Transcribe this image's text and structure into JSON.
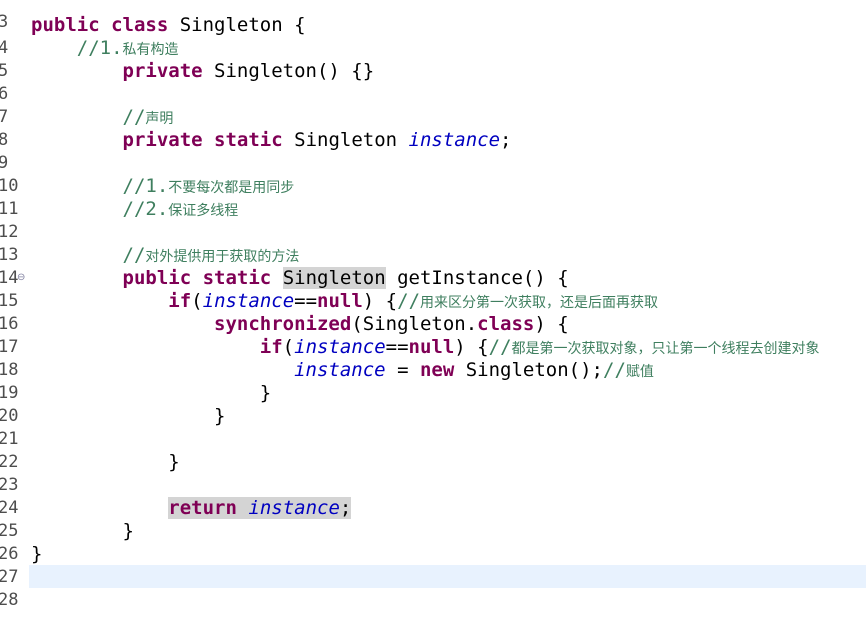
{
  "editor": {
    "lines": [
      {
        "n": "3"
      },
      {
        "n": "4"
      },
      {
        "n": "5"
      },
      {
        "n": "6"
      },
      {
        "n": "7"
      },
      {
        "n": "8"
      },
      {
        "n": "9"
      },
      {
        "n": "10"
      },
      {
        "n": "11"
      },
      {
        "n": "12"
      },
      {
        "n": "13"
      },
      {
        "n": "14"
      },
      {
        "n": "15"
      },
      {
        "n": "16"
      },
      {
        "n": "17"
      },
      {
        "n": "18"
      },
      {
        "n": "19"
      },
      {
        "n": "20"
      },
      {
        "n": "21"
      },
      {
        "n": "22"
      },
      {
        "n": "23"
      },
      {
        "n": "24"
      },
      {
        "n": "25"
      },
      {
        "n": "26"
      },
      {
        "n": "27"
      },
      {
        "n": "28"
      }
    ],
    "fold_marker": "⊖",
    "tokens": {
      "l4": {
        "kw1": "public",
        "kw2": "class",
        "name": " Singleton {"
      },
      "l5": {
        "c1": "//1.",
        "c2": "私有构造"
      },
      "l6": {
        "kw": "private",
        "rest": " Singleton() {}"
      },
      "l8": {
        "c1": "//",
        "c2": "声明"
      },
      "l9": {
        "kw1": "private",
        "kw2": "static",
        "type": " Singleton ",
        "field": "instance",
        "semi": ";"
      },
      "l11": {
        "c1": "//1.",
        "c2": "不要每次都是用同步"
      },
      "l12": {
        "c1": "//2.",
        "c2": "保证多线程"
      },
      "l14": {
        "c1": "//",
        "c2": "对外提供用于获取的方法"
      },
      "l15": {
        "kw1": "public",
        "kw2": "static",
        "type": "Singleton",
        "rest": " getInstance() {"
      },
      "l16": {
        "kw": "if",
        "p1": "(",
        "field": "instance",
        "op": "==",
        "kwnull": "null",
        "p2": ") {",
        "c1": "//",
        "c2": "用来区分第一次获取，还是后面再获取"
      },
      "l17": {
        "kw": "synchronized",
        "rest": "(Singleton.",
        "kwclass": "class",
        "p2": ") {"
      },
      "l18": {
        "kw": "if",
        "p1": "(",
        "field": "instance",
        "op": "==",
        "kwnull": "null",
        "p2": ") {",
        "c1": "//",
        "c2": "都是第一次获取对象，只让第一个线程去创建对象"
      },
      "l19": {
        "field": "instance",
        "op": " = ",
        "kwnew": "new",
        "rest": " Singleton();",
        "c1": "//",
        "c2": "赋值"
      },
      "l20": {
        "brace": "}"
      },
      "l21": {
        "brace": "}"
      },
      "l23": {
        "brace": "}"
      },
      "l25": {
        "kw": "return",
        "field": "instance",
        "semi": ";"
      },
      "l26": {
        "brace": "}"
      },
      "l27": {
        "brace": "}"
      }
    }
  }
}
